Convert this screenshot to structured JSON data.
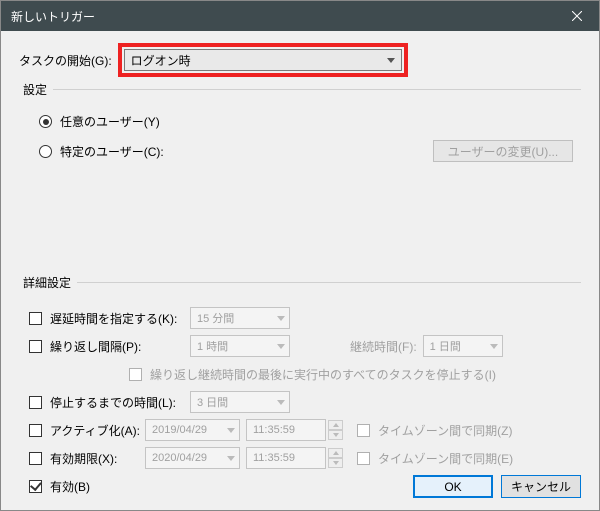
{
  "title": "新しいトリガー",
  "top": {
    "label": "タスクの開始(G):",
    "value": "ログオン時"
  },
  "settings": {
    "group_label": "設定",
    "any_user": "任意のユーザー(Y)",
    "specific_user": "特定のユーザー(C):",
    "change_user_btn": "ユーザーの変更(U)..."
  },
  "advanced": {
    "group_label": "詳細設定",
    "delay_label": "遅延時間を指定する(K):",
    "delay_value": "15 分間",
    "repeat_label": "繰り返し間隔(P):",
    "repeat_value": "1 時間",
    "duration_label": "継続時間(F):",
    "duration_value": "1 日間",
    "stop_all_label": "繰り返し継続時間の最後に実行中のすべてのタスクを停止する(I)",
    "stop_after_label": "停止するまでの時間(L):",
    "stop_after_value": "3 日間",
    "activate_label": "アクティブ化(A):",
    "activate_date": "2019/04/29",
    "activate_time": "11:35:59",
    "tz_sync_z": "タイムゾーン間で同期(Z)",
    "expire_label": "有効期限(X):",
    "expire_date": "2020/04/29",
    "expire_time": "11:35:59",
    "tz_sync_e": "タイムゾーン間で同期(E)",
    "enabled_label": "有効(B)"
  },
  "buttons": {
    "ok": "OK",
    "cancel": "キャンセル"
  }
}
